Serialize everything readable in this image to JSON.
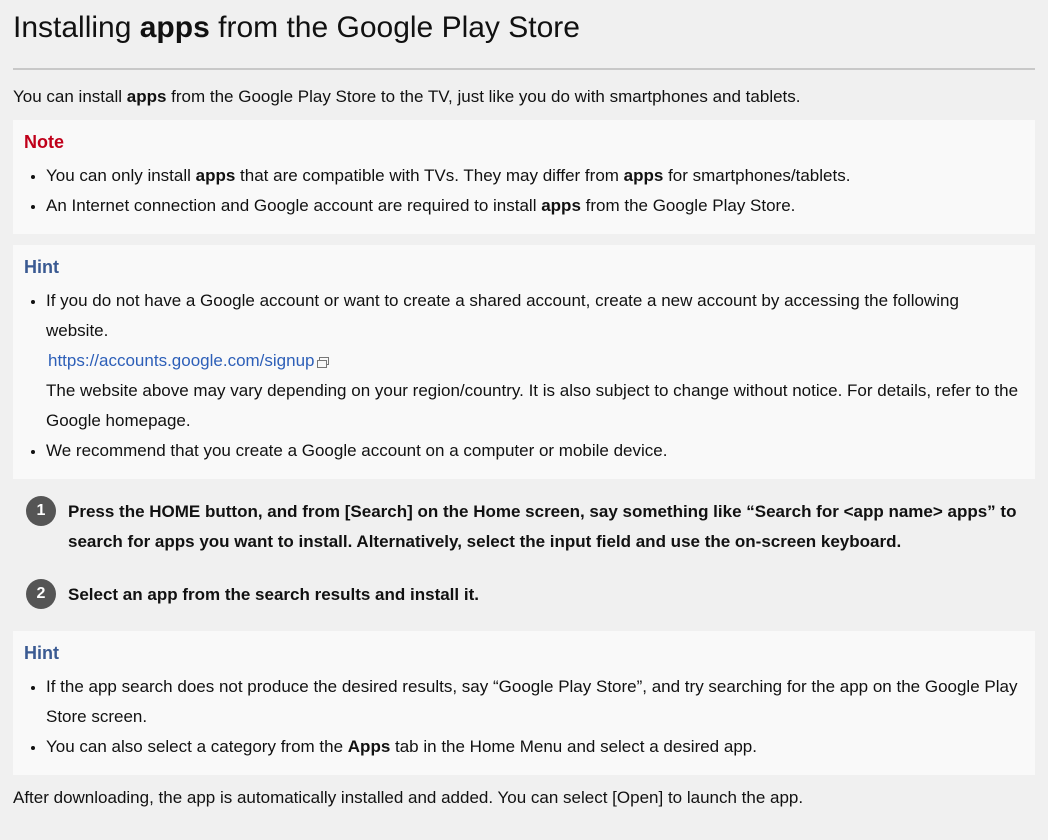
{
  "title": {
    "before": "Installing ",
    "bold": "apps",
    "after": " from the Google Play Store"
  },
  "intro": {
    "before": "You can install ",
    "bold": "apps",
    "after": " from the Google Play Store to the TV, just like you do with smartphones and tablets."
  },
  "note": {
    "title": "Note",
    "items": [
      {
        "t1": "You can only install ",
        "b1": "apps",
        "t2": " that are compatible with TVs. They may differ from ",
        "b2": "apps",
        "t3": " for smartphones/tablets."
      },
      {
        "t1": "An Internet connection and Google account are required to install ",
        "b1": "apps",
        "t2": " from the Google Play Store."
      }
    ]
  },
  "hint1": {
    "title": "Hint",
    "item1_text": "If you do not have a Google account or want to create a shared account, create a new account by accessing the following website.",
    "link": "https://accounts.google.com/signup",
    "item1_after": "The website above may vary depending on your region/country. It is also subject to change without notice. For details, refer to the Google homepage.",
    "item2": "We recommend that you create a Google account on a computer or mobile device."
  },
  "steps": [
    {
      "num": "1",
      "text": "Press the HOME button, and from [Search] on the Home screen, say something like “Search for <app name> apps” to search for apps you want to install. Alternatively, select the input field and use the on-screen keyboard."
    },
    {
      "num": "2",
      "text": "Select an app from the search results and install it."
    }
  ],
  "hint2": {
    "title": "Hint",
    "item1": "If the app search does not produce the desired results, say “Google Play Store”, and try searching for the app on the Google Play Store screen.",
    "item2_before": "You can also select a category from the ",
    "item2_bold": "Apps",
    "item2_after": " tab in the Home Menu and select a desired app."
  },
  "outro": "After downloading, the app is automatically installed and added. You can select [Open] to launch the app."
}
